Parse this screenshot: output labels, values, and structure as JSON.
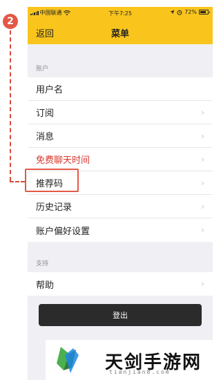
{
  "annotation": {
    "step_number": "2"
  },
  "status_bar": {
    "carrier": "中国联通",
    "time": "下午7:25",
    "battery": "72%"
  },
  "nav": {
    "back_label": "返回",
    "title": "菜单"
  },
  "sections": [
    {
      "label": "账户",
      "items": [
        {
          "label": "用户名",
          "chevron": false,
          "highlight": false
        },
        {
          "label": "订阅",
          "chevron": true,
          "highlight": false
        },
        {
          "label": "消息",
          "chevron": true,
          "highlight": false
        },
        {
          "label": "免费聊天时间",
          "chevron": true,
          "highlight": true
        },
        {
          "label": "推荐码",
          "chevron": true,
          "highlight": false
        },
        {
          "label": "历史记录",
          "chevron": true,
          "highlight": false
        },
        {
          "label": "账户偏好设置",
          "chevron": true,
          "highlight": false
        }
      ]
    },
    {
      "label": "支持",
      "items": [
        {
          "label": "帮助",
          "chevron": true,
          "highlight": false
        }
      ]
    }
  ],
  "logout_label": "登出",
  "watermark": {
    "title": "天剑手游网",
    "subtitle": "tianjian8.com"
  },
  "colors": {
    "nav_yellow": "#f9c51d",
    "accent_red": "#d9352b",
    "annotation_red": "#e25845"
  },
  "icons": {
    "chevron": "›",
    "wifi": "wifi-icon",
    "location": "location-icon",
    "alarm": "alarm-icon"
  }
}
